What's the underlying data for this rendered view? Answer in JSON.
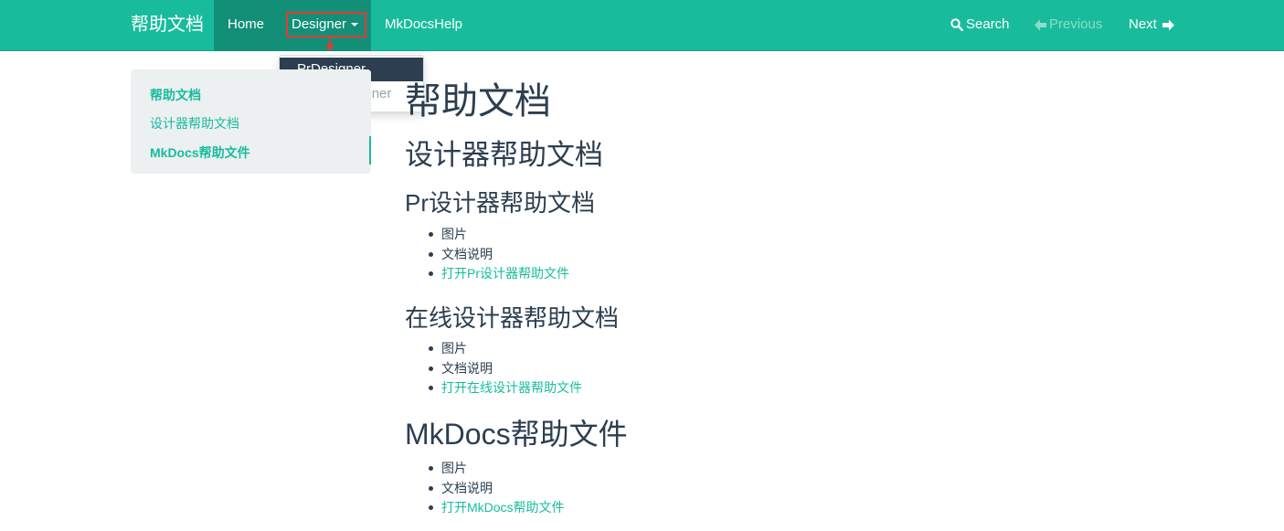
{
  "navbar": {
    "brand": "帮助文档",
    "home": "Home",
    "designer": "Designer",
    "mkdocshelp": "MkDocsHelp",
    "search": "Search",
    "previous": "Previous",
    "next": "Next"
  },
  "dropdown": {
    "items": [
      {
        "label": "PrDesigner",
        "active": true
      },
      {
        "label": "OnlineDesigner",
        "active": false
      }
    ]
  },
  "sidebar": {
    "items": [
      {
        "label": "帮助文档"
      },
      {
        "label": "设计器帮助文档"
      },
      {
        "label": "MkDocs帮助文件"
      }
    ]
  },
  "content": {
    "h1": "帮助文档",
    "h2_designer": "设计器帮助文档",
    "section_pr": {
      "title": "Pr设计器帮助文档",
      "items": [
        "图片",
        "文档说明",
        "打开Pr设计器帮助文件"
      ]
    },
    "section_online": {
      "title": "在线设计器帮助文档",
      "items": [
        "图片",
        "文档说明",
        "打开在线设计器帮助文件"
      ]
    },
    "section_mkdocs": {
      "title": "MkDocs帮助文件",
      "items": [
        "图片",
        "文档说明",
        "打开MkDocs帮助文件"
      ]
    }
  },
  "colors": {
    "navbar": "#18bc9c",
    "navbar_active": "#128f76",
    "dark": "#2c3e50",
    "link": "#18bc9c",
    "annotation": "#e53935"
  }
}
